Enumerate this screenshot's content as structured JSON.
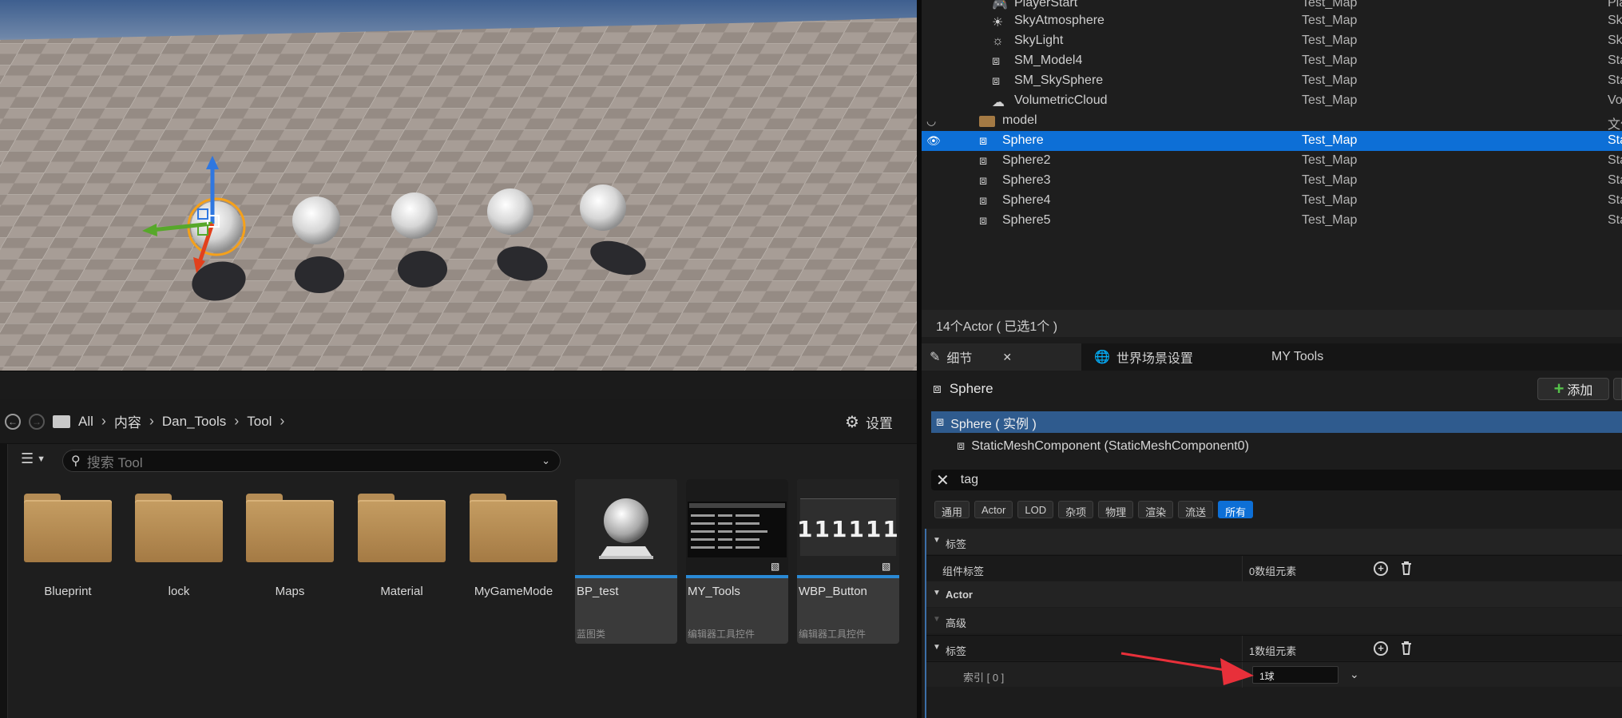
{
  "outliner": {
    "rows": [
      {
        "name": "PlayerStart",
        "map": "Test_Map",
        "type": "PlayerS",
        "icon": "player-start-icon"
      },
      {
        "name": "SkyAtmosphere",
        "map": "Test_Map",
        "type": "SkyAtn",
        "icon": "sky-atmosphere-icon"
      },
      {
        "name": "SkyLight",
        "map": "Test_Map",
        "type": "SkyLig",
        "icon": "sky-light-icon"
      },
      {
        "name": "SM_Model4",
        "map": "Test_Map",
        "type": "StaticM",
        "icon": "static-mesh-icon"
      },
      {
        "name": "SM_SkySphere",
        "map": "Test_Map",
        "type": "StaticM",
        "icon": "static-mesh-icon"
      },
      {
        "name": "VolumetricCloud",
        "map": "Test_Map",
        "type": "Volum",
        "icon": "volumetric-cloud-icon"
      },
      {
        "name": "model",
        "map": "",
        "type": "文件夹",
        "icon": "folder-icon"
      },
      {
        "name": "Sphere",
        "map": "Test_Map",
        "type": "StaticM",
        "icon": "static-mesh-icon"
      },
      {
        "name": "Sphere2",
        "map": "Test_Map",
        "type": "StaticM",
        "icon": "static-mesh-icon"
      },
      {
        "name": "Sphere3",
        "map": "Test_Map",
        "type": "StaticM",
        "icon": "static-mesh-icon"
      },
      {
        "name": "Sphere4",
        "map": "Test_Map",
        "type": "StaticM",
        "icon": "static-mesh-icon"
      },
      {
        "name": "Sphere5",
        "map": "Test_Map",
        "type": "StaticM",
        "icon": "static-mesh-icon"
      }
    ],
    "footer": "14个Actor ( 已选1个 )"
  },
  "content_browser": {
    "path": [
      "All",
      "内容",
      "Dan_Tools",
      "Tool"
    ],
    "settings_label": "设置",
    "search_placeholder": "搜索 Tool",
    "folders": [
      "Blueprint",
      "lock",
      "Maps",
      "Material",
      "MyGameMode"
    ],
    "assets": [
      {
        "name": "BP_test",
        "type": "蓝图类"
      },
      {
        "name": "MY_Tools",
        "type": "编辑器工具控件"
      },
      {
        "name": "WBP_Button",
        "type": "编辑器工具控件",
        "thumb_text": "111111"
      }
    ]
  },
  "details": {
    "tabs": [
      "细节",
      "世界场景设置",
      "MY Tools"
    ],
    "actor_name": "Sphere",
    "add_label": "添加",
    "instance_label": "Sphere ( 实例 )",
    "component_label": "StaticMeshComponent (StaticMeshComponent0)",
    "search_value": "tag",
    "filters": [
      "通用",
      "Actor",
      "LOD",
      "杂项",
      "物理",
      "渲染",
      "流送",
      "所有"
    ],
    "active_filter": "所有",
    "props": {
      "cat1": "标签",
      "comp_tags_label": "组件标签",
      "comp_tags_value": "0数组元素",
      "cat_actor": "Actor",
      "cat_advanced": "高级",
      "tags_label": "标签",
      "tags_value": "1数组元素",
      "index_label": "索引 [ 0 ]",
      "index_value": "1球"
    }
  },
  "colors": {
    "selection": "#0d6fd6",
    "accent_red": "#e8303a",
    "add_green": "#55c14a"
  }
}
